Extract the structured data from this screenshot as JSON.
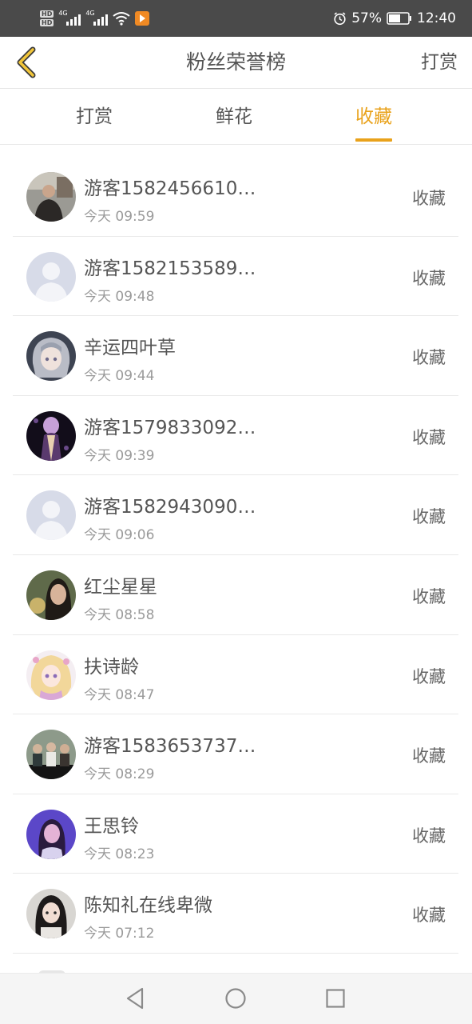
{
  "status_bar": {
    "battery": "57%",
    "time": "12:40",
    "network": "4G",
    "hd_label": "HD"
  },
  "nav": {
    "title": "粉丝荣誉榜",
    "action": "打赏",
    "back_icon": "chevron-left-icon"
  },
  "tabs": [
    {
      "label": "打赏",
      "active": false
    },
    {
      "label": "鲜花",
      "active": false
    },
    {
      "label": "收藏",
      "active": true
    }
  ],
  "accent_color": "#e9a21b",
  "list": [
    {
      "name": "游客1582456610…",
      "time": "今天 09:59",
      "action": "收藏",
      "avatar": "photo-man"
    },
    {
      "name": "游客1582153589…",
      "time": "今天 09:48",
      "action": "收藏",
      "avatar": "default-user"
    },
    {
      "name": "辛运四叶草",
      "time": "今天 09:44",
      "action": "收藏",
      "avatar": "anime-gray"
    },
    {
      "name": "游客1579833092…",
      "time": "今天 09:39",
      "action": "收藏",
      "avatar": "stage-dark"
    },
    {
      "name": "游客1582943090…",
      "time": "今天 09:06",
      "action": "收藏",
      "avatar": "default-user"
    },
    {
      "name": "红尘星星",
      "time": "今天 08:58",
      "action": "收藏",
      "avatar": "photo-woman"
    },
    {
      "name": "扶诗龄",
      "time": "今天 08:47",
      "action": "收藏",
      "avatar": "anime-light"
    },
    {
      "name": "游客1583653737…",
      "time": "今天 08:29",
      "action": "收藏",
      "avatar": "photo-group"
    },
    {
      "name": "王思铃",
      "time": "今天 08:23",
      "action": "收藏",
      "avatar": "photo-purple"
    },
    {
      "name": "陈知礼在线卑微",
      "time": "今天 07:12",
      "action": "收藏",
      "avatar": "photo-girl"
    }
  ],
  "system_nav": [
    "back-triangle-icon",
    "home-circle-icon",
    "recents-square-icon"
  ]
}
